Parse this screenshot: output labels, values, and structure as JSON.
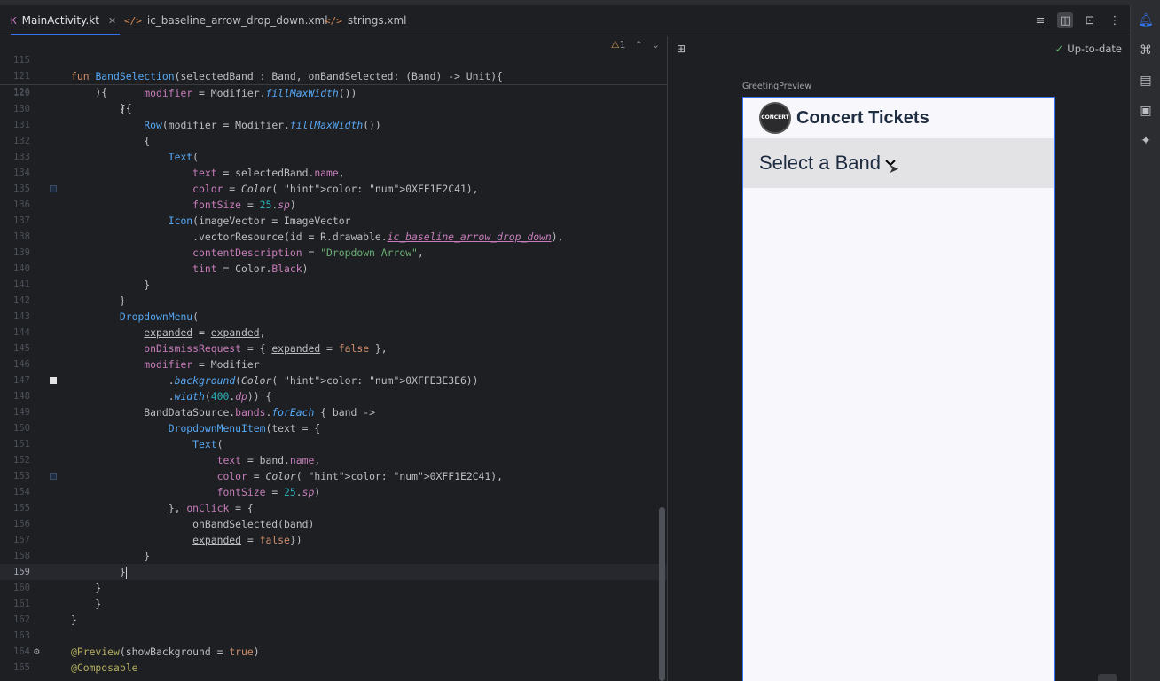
{
  "tabs": [
    {
      "label": "MainActivity.kt",
      "icon": "kotlin-file-icon",
      "active": true
    },
    {
      "label": "ic_baseline_arrow_drop_down.xml",
      "icon": "xml-file-icon",
      "active": false
    },
    {
      "label": "strings.xml",
      "icon": "xml-file-icon",
      "active": false
    }
  ],
  "editor": {
    "warning_count": "1",
    "sticky_lines": [
      {
        "num": "115",
        "text": "fun BandSelection(selectedBand : Band, onBandSelected: (Band) -> Unit){"
      },
      {
        "num": "121",
        "text": "    ){"
      },
      {
        "num": "126",
        "text": "        ){"
      }
    ],
    "lines": [
      {
        "num": "129",
        "text": "            modifier = Modifier.fillMaxWidth())"
      },
      {
        "num": "130",
        "text": "        {"
      },
      {
        "num": "131",
        "text": "            Row(modifier = Modifier.fillMaxWidth())"
      },
      {
        "num": "132",
        "text": "            {"
      },
      {
        "num": "133",
        "text": "                Text("
      },
      {
        "num": "134",
        "text": "                    text = selectedBand.name,"
      },
      {
        "num": "135",
        "text": "                    color = Color( color: 0XFF1E2C41),"
      },
      {
        "num": "136",
        "text": "                    fontSize = 25.sp)"
      },
      {
        "num": "137",
        "text": "                Icon(imageVector = ImageVector"
      },
      {
        "num": "138",
        "text": "                    .vectorResource(id = R.drawable.ic_baseline_arrow_drop_down),"
      },
      {
        "num": "139",
        "text": "                    contentDescription = \"Dropdown Arrow\","
      },
      {
        "num": "140",
        "text": "                    tint = Color.Black)"
      },
      {
        "num": "141",
        "text": "            }"
      },
      {
        "num": "142",
        "text": "        }"
      },
      {
        "num": "143",
        "text": "        DropdownMenu("
      },
      {
        "num": "144",
        "text": "            expanded = expanded,"
      },
      {
        "num": "145",
        "text": "            onDismissRequest = { expanded = false },"
      },
      {
        "num": "146",
        "text": "            modifier = Modifier"
      },
      {
        "num": "147",
        "text": "                .background(Color( color: 0XFFE3E3E6))"
      },
      {
        "num": "148",
        "text": "                .width(400.dp)) {"
      },
      {
        "num": "149",
        "text": "            BandDataSource.bands.forEach { band ->"
      },
      {
        "num": "150",
        "text": "                DropdownMenuItem(text = {"
      },
      {
        "num": "151",
        "text": "                    Text("
      },
      {
        "num": "152",
        "text": "                        text = band.name,"
      },
      {
        "num": "153",
        "text": "                        color = Color( color: 0XFF1E2C41),"
      },
      {
        "num": "154",
        "text": "                        fontSize = 25.sp)"
      },
      {
        "num": "155",
        "text": "                }, onClick = {"
      },
      {
        "num": "156",
        "text": "                    onBandSelected(band)"
      },
      {
        "num": "157",
        "text": "                    expanded = false})"
      },
      {
        "num": "158",
        "text": "            }"
      },
      {
        "num": "159",
        "text": "        }"
      },
      {
        "num": "160",
        "text": "    }"
      },
      {
        "num": "161",
        "text": "    }"
      },
      {
        "num": "162",
        "text": "}"
      },
      {
        "num": "163",
        "text": ""
      },
      {
        "num": "164",
        "text": "@Preview(showBackground = true)"
      },
      {
        "num": "165",
        "text": "@Composable"
      }
    ]
  },
  "preview": {
    "status": "Up-to-date",
    "composable_name": "GreetingPreview",
    "app_title": "Concert Tickets",
    "logo_text": "CONCERT",
    "band_select_label": "Select a Band"
  },
  "colors": {
    "accent": "#3574f0",
    "text_dark": "#1e2c41",
    "menu_bg": "#e3e3e6"
  }
}
